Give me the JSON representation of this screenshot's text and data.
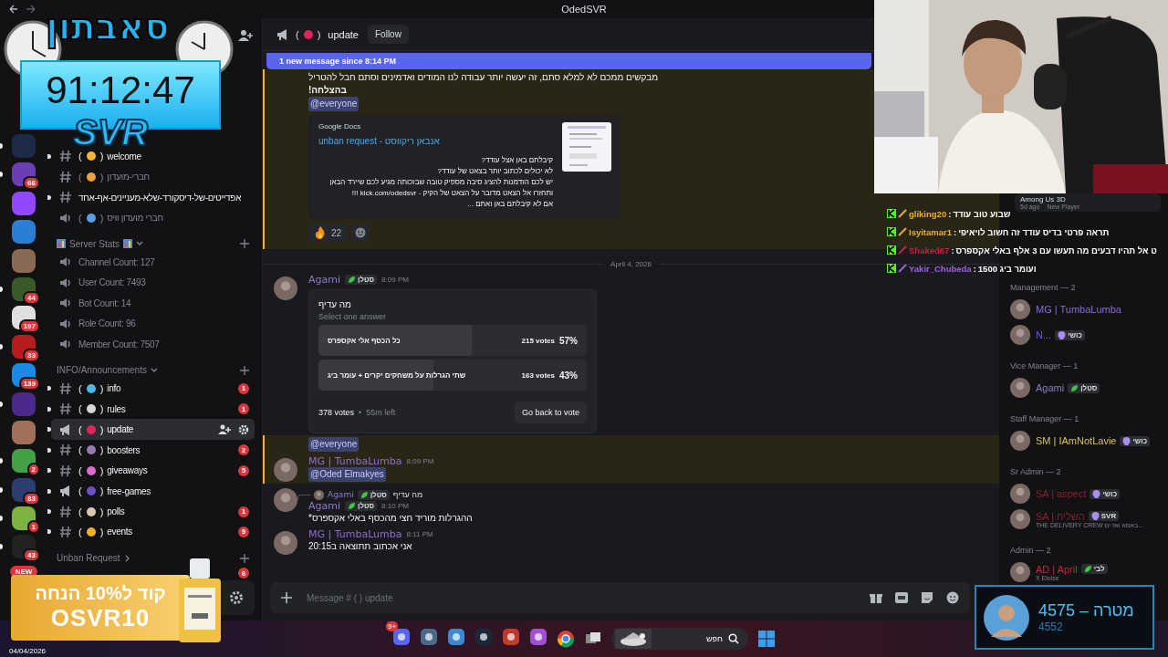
{
  "window": {
    "title": "OdedSVR"
  },
  "overlay": {
    "event_title": "סאבתון",
    "timer": "91:12:47",
    "brand": "SVR"
  },
  "servers": [
    {
      "color": "#1e2a4a",
      "unread": true
    },
    {
      "color": "#6a3fb5",
      "unread": true,
      "badge": "66"
    },
    {
      "color": "#9146ff",
      "unread": false
    },
    {
      "color": "#2a7fd4",
      "unread": false
    },
    {
      "color": "#8a6a55",
      "unread": false
    },
    {
      "color": "#3a5a2a",
      "unread": true,
      "badge": "44"
    },
    {
      "color": "#e0e0e0",
      "unread": false,
      "badge": "197"
    },
    {
      "color": "#b71c1c",
      "unread": true,
      "badge": "33"
    },
    {
      "color": "#1e88e5",
      "unread": false,
      "badge": "139"
    },
    {
      "color": "#4a2a8a",
      "unread": true
    },
    {
      "color": "#a0705a",
      "unread": false
    },
    {
      "color": "#43a047",
      "unread": true,
      "badge": "2"
    },
    {
      "color": "#2c3e70",
      "unread": true,
      "badge": "83"
    },
    {
      "color": "#7cb342",
      "unread": true,
      "badge": "1"
    },
    {
      "color": "#222222",
      "unread": true,
      "badge": "43"
    }
  ],
  "servers_new": "NEW",
  "channels": [
    {
      "kind": "text",
      "open": "(",
      "close": ")",
      "name": "welcome",
      "color": "#f5b63a",
      "unread": true,
      "selected": false
    },
    {
      "kind": "text",
      "open": "(",
      "close": ")",
      "name": "חברי-מועדון",
      "color": "#e8a33c",
      "unread": false,
      "selected": false
    },
    {
      "kind": "text",
      "name": "אפדייטים-של-דיסקורד-שלא-מעניינים-אף-אחד",
      "unread": true,
      "selected": false
    },
    {
      "kind": "voice",
      "open": "(",
      "close": ")",
      "name": "חברי מועדון וויס",
      "color": "#5aa0e6",
      "unread": false,
      "selected": false
    }
  ],
  "categories": [
    {
      "name": "Server Stats",
      "expanded": true,
      "emoji": true,
      "channels": [
        {
          "kind": "voice",
          "name": "Channel Count: 127",
          "unread": false,
          "selected": false
        },
        {
          "kind": "voice",
          "name": "User Count: 7493",
          "unread": false,
          "selected": false
        },
        {
          "kind": "voice",
          "name": "Bot Count: 14",
          "unread": false,
          "selected": false
        },
        {
          "kind": "voice",
          "name": "Role Count: 96",
          "unread": false,
          "selected": false
        },
        {
          "kind": "voice",
          "name": "Member Count: 7507",
          "unread": false,
          "selected": false
        }
      ]
    },
    {
      "name": "INFO/Announcements",
      "expanded": true,
      "emoji": false,
      "channels": [
        {
          "kind": "text",
          "open": "(",
          "close": ")",
          "name": "info",
          "color": "#4fb8e8",
          "unread": true,
          "selected": false,
          "mentions": "1"
        },
        {
          "kind": "text",
          "open": "(",
          "close": ")",
          "name": "rules",
          "color": "#d8d8d8",
          "unread": true,
          "selected": false,
          "mentions": "1"
        },
        {
          "kind": "announcement",
          "open": "(",
          "close": ")",
          "name": "update",
          "color": "#e0245e",
          "unread": true,
          "selected": true
        },
        {
          "kind": "text",
          "open": "(",
          "close": ")",
          "name": "boosters",
          "color": "#9a7ab0",
          "unread": true,
          "selected": false,
          "mentions": "2"
        },
        {
          "kind": "text",
          "open": "(",
          "close": ")",
          "name": "giveaways",
          "color": "#e06ad0",
          "unread": true,
          "selected": false,
          "mentions": "5"
        },
        {
          "kind": "announcement",
          "open": "(",
          "close": ")",
          "name": "free-games",
          "color": "#6a4fc8",
          "unread": true,
          "selected": false
        },
        {
          "kind": "text",
          "open": "(",
          "close": ")",
          "name": "polls",
          "color": "#d8c8b0",
          "unread": true,
          "selected": false,
          "mentions": "1"
        },
        {
          "kind": "text",
          "open": "(",
          "close": ")",
          "name": "events",
          "color": "#f0b020",
          "unread": true,
          "selected": false,
          "mentions": "9"
        }
      ]
    },
    {
      "name": "Unban Request",
      "expanded": false,
      "emoji": false,
      "mentions": "6"
    }
  ],
  "channel_header": {
    "open": "(",
    "close": ")",
    "name": "update",
    "color": "#e0245e",
    "follow": "Follow"
  },
  "new_messages": "1 new message since 8:14 PM",
  "messages": [
    {
      "kind": "continuation",
      "mention": true,
      "lines": [
        "מבקשים ממכם לא למלא סתם, זה יעשה יותר עבודה לנו המודים ואדמינים וסתם חבל להטריל"
      ],
      "bold_line": "בהצלחה!",
      "ping": "@everyone",
      "embed": {
        "provider": "Google Docs",
        "title": "unban request - אנבאן ריקווסט",
        "description": [
          "קיבלתם באן אצל עודד?",
          "לא יכולים לכתוב יותר בצאט של עודד?",
          "יש לכם הזדמנות להציג סיבה מספיק טובה שבזכותה מגיע לכם שיירד הבאן",
          "ותחזרו אל הצאט מדובר על הצאט של הקיק - kick.com/odedsvr !!!",
          "אם לא קיבלתם באן ואתם ..."
        ]
      },
      "reactions": [
        {
          "count": "22",
          "selected": false
        }
      ]
    },
    {
      "kind": "divider",
      "text": "April 4, 2026"
    },
    {
      "kind": "poll",
      "author": "Agami",
      "tag": "סטלן",
      "color": "#8e7cc3",
      "time": "8:09 PM",
      "mention": false,
      "poll": {
        "question": "מה עדיף",
        "hint": "Select one answer",
        "answers": [
          {
            "text": "כל הכסף אלי אקספרס",
            "votes": "215 votes",
            "percent": "57%",
            "level": 0.57
          },
          {
            "text": "שתי הגרלות על משחקים יקרים + עומר ביג",
            "votes": "163 votes",
            "percent": "43%",
            "level": 0.43
          }
        ],
        "total": "378 votes",
        "sep": "•",
        "left": "55m left",
        "button": "Go back to vote"
      }
    },
    {
      "kind": "continuation",
      "mention": true,
      "ping": "@everyone"
    },
    {
      "kind": "message",
      "author": "MG | TumbaLumba",
      "color": "#8e6bd8",
      "time": "8:09 PM",
      "mention": true,
      "ping": "@Oded Elmakyes"
    },
    {
      "kind": "message",
      "author": "Agami",
      "tag": "סטלן",
      "color": "#8e7cc3",
      "time": "8:10 PM",
      "mention": false,
      "reply": {
        "author": "Agami",
        "tag": "סטלן",
        "text": "מה עדיף"
      },
      "text": "ההגרלות מוריד חצי מהכסף באלי אקספרס*"
    },
    {
      "kind": "message",
      "author": "MG | TumbaLumba",
      "color": "#8e6bd8",
      "time": "8:11 PM",
      "mention": false,
      "text": "אני אכתוב תתוצאה ב20:15"
    }
  ],
  "composer": {
    "placeholder": "Message # ( ) update"
  },
  "members": {
    "activity": {
      "game": "Among Us 3D",
      "ago": "5d ago",
      "status": "New Player"
    },
    "groups": [
      {
        "title": "Management — 2",
        "members": [
          {
            "name": "MG | TumbaLumba",
            "color": "#8e6bd8"
          },
          {
            "name": "N...",
            "color": "#6a5ad8",
            "tag": "כושי",
            "leaf": false
          }
        ]
      },
      {
        "title": "Vice Manager — 1",
        "members": [
          {
            "name": "Agami",
            "color": "#8e7cc3",
            "tag": "סטלן",
            "leaf": true
          }
        ]
      },
      {
        "title": "Staff Manager — 1",
        "members": [
          {
            "name": "SM | IAmNotLavie",
            "color": "#d8c060",
            "tag": "כושי",
            "leaf": false
          }
        ]
      },
      {
        "title": "Sr Admin — 2",
        "members": [
          {
            "name": "SA | aspect",
            "color": "#8a2030",
            "tag": "כושי",
            "leaf": false
          },
          {
            "name": "SA | השליח",
            "color": "#8a2030",
            "tag": "SVR",
            "leaf": false,
            "status": "THE DELIVERY CREW באמא ואז ים..."
          }
        ]
      },
      {
        "title": "Admin — 2",
        "members": [
          {
            "name": "AD | April",
            "color": "#d02040",
            "tag": "לבי",
            "leaf": true,
            "status": "X Eloise"
          }
        ]
      }
    ]
  },
  "kick_chat": [
    {
      "user": "gliking20",
      "color": "#e8b030",
      "colon": ":",
      "text": "שבוע טוב עודד"
    },
    {
      "user": "Isyitamar1",
      "color": "#e8b030",
      "colon": ":",
      "text": "תראה פרטי בדיס עודד זה חשוב לויאיפי"
    },
    {
      "user": "Shaked67",
      "color": "#d02040",
      "colon": ":",
      "text": "ט אל תהיו דבעים מה תעשו עם 3 אלף באלי אקספרס"
    },
    {
      "user": "Yakir_Chubeda",
      "color": "#a060e0",
      "colon": ":",
      "text": "ועומר ביג 1500"
    }
  ],
  "goal": {
    "label": "מטרה – 4575",
    "current": "4552"
  },
  "promo": {
    "line1": "קוד ל10% הנחה",
    "code": "OSVR10"
  },
  "taskbar": {
    "date": "04/04/2026",
    "badge": "9+",
    "search": "חפש"
  }
}
